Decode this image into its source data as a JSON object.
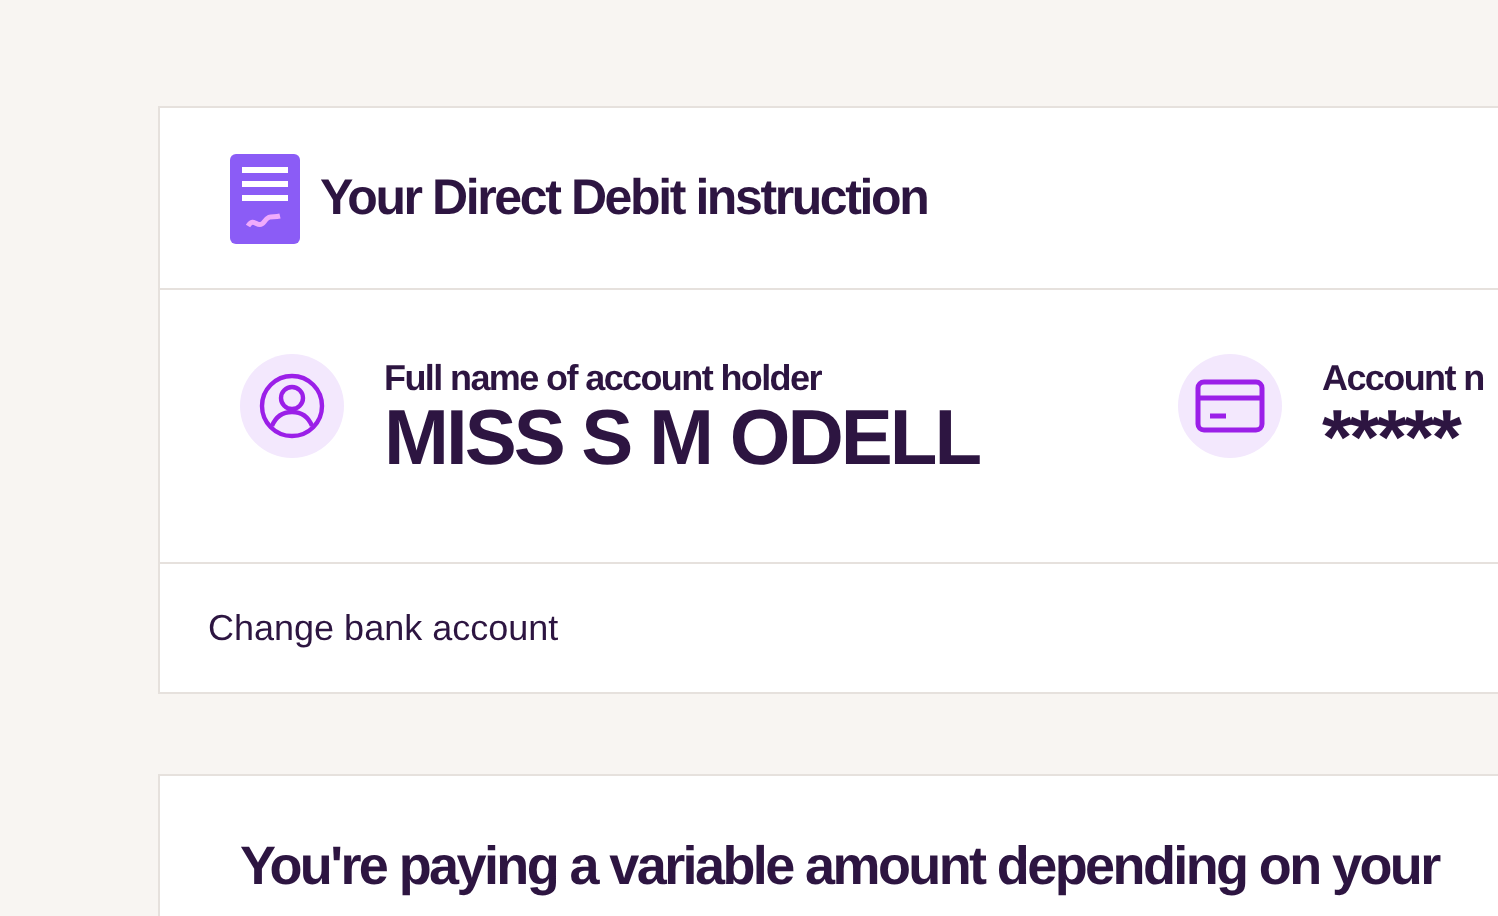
{
  "instruction_card": {
    "title": "Your Direct Debit instruction",
    "details": [
      {
        "kind": "person",
        "label": "Full name of account holder",
        "value": "MISS S M ODELL"
      },
      {
        "kind": "card",
        "label": "Account n",
        "value": "*****"
      }
    ],
    "link": "Change bank account"
  },
  "payment_card": {
    "heading": "You're paying a variable amount depending on your"
  }
}
